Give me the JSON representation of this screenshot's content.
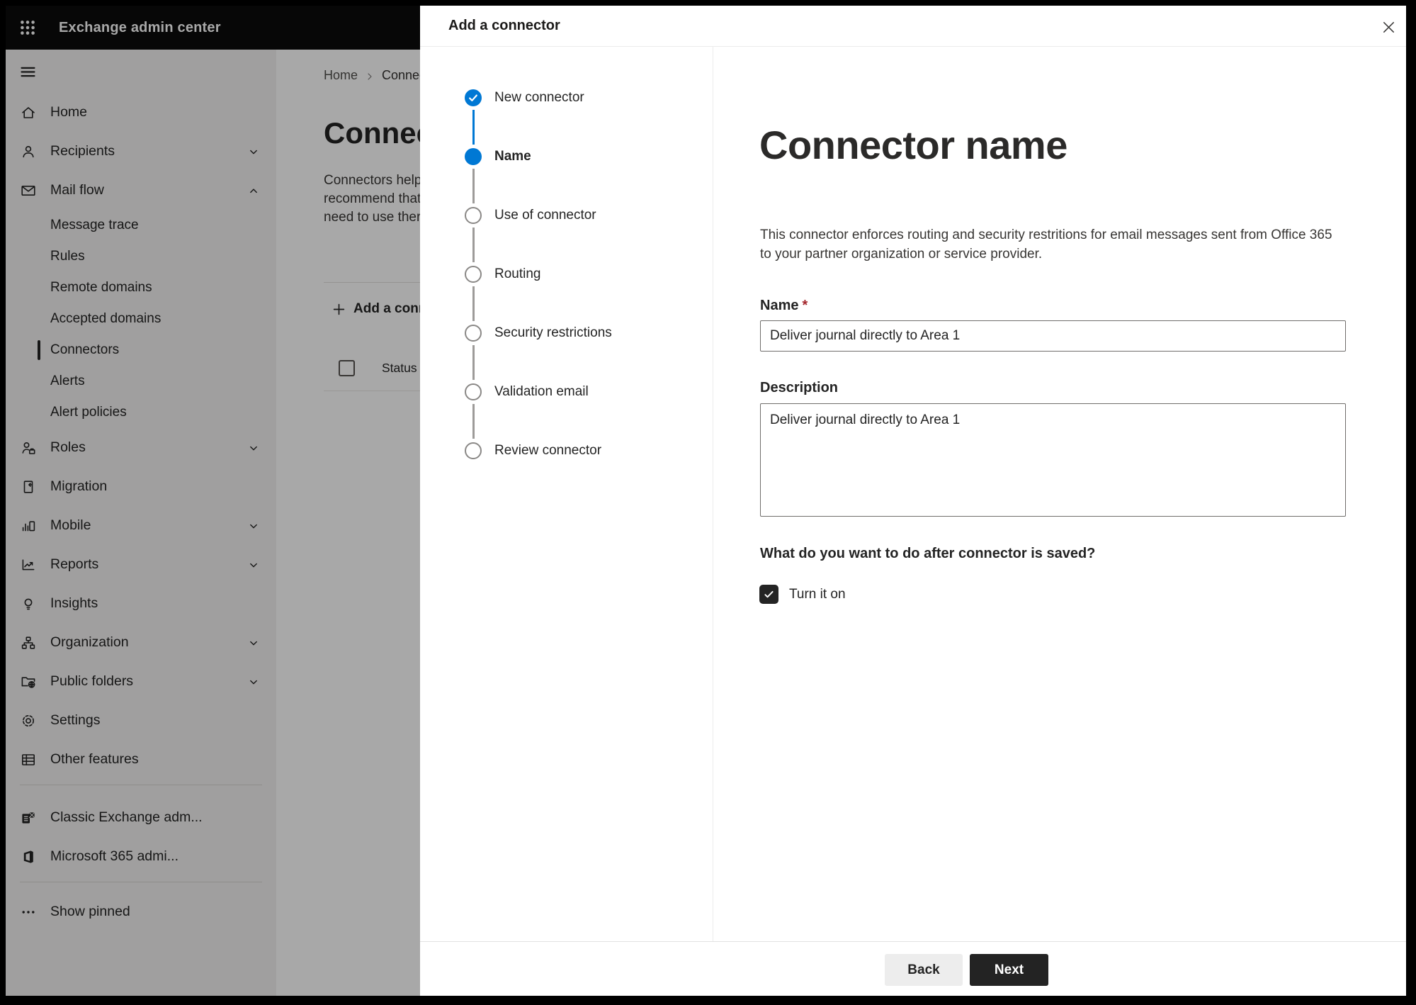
{
  "topbar": {
    "title": "Exchange admin center"
  },
  "sidebar": {
    "items": [
      {
        "label": "Home"
      },
      {
        "label": "Recipients"
      },
      {
        "label": "Mail flow"
      },
      {
        "label": "Message trace"
      },
      {
        "label": "Rules"
      },
      {
        "label": "Remote domains"
      },
      {
        "label": "Accepted domains"
      },
      {
        "label": "Connectors",
        "selected": true
      },
      {
        "label": "Alerts"
      },
      {
        "label": "Alert policies"
      },
      {
        "label": "Roles"
      },
      {
        "label": "Migration"
      },
      {
        "label": "Mobile"
      },
      {
        "label": "Reports"
      },
      {
        "label": "Insights"
      },
      {
        "label": "Organization"
      },
      {
        "label": "Public folders"
      },
      {
        "label": "Settings"
      },
      {
        "label": "Other features"
      },
      {
        "label": "Classic Exchange adm..."
      },
      {
        "label": "Microsoft 365 admi..."
      },
      {
        "label": "Show pinned"
      }
    ]
  },
  "main": {
    "breadcrumb": {
      "home": "Home",
      "current": "Connectors"
    },
    "title": "Connectors",
    "paragraph_lines": [
      "Connectors help",
      "recommend that",
      "need to use ther"
    ],
    "add_button_label": "Add a connector",
    "table": {
      "status_header": "Status"
    }
  },
  "dialog": {
    "title": "Add a connector",
    "steps": [
      {
        "label": "New connector",
        "state": "completed"
      },
      {
        "label": "Name",
        "state": "current"
      },
      {
        "label": "Use of connector",
        "state": "upcoming"
      },
      {
        "label": "Routing",
        "state": "upcoming"
      },
      {
        "label": "Security restrictions",
        "state": "upcoming"
      },
      {
        "label": "Validation email",
        "state": "upcoming"
      },
      {
        "label": "Review connector",
        "state": "upcoming"
      }
    ],
    "heading": "Connector name",
    "description_lines": [
      "This connector enforces routing and security restritions for email messages sent from Office 365",
      "to your partner organization or service provider."
    ],
    "name_label": "Name",
    "required_mark": "*",
    "name_value": "Deliver journal directly to Area 1",
    "description_label": "Description",
    "description_value": "Deliver journal directly to Area 1",
    "question": "What do you want to do after connector is saved?",
    "checkbox_label": "Turn it on",
    "checkbox_checked": true,
    "back_label": "Back",
    "next_label": "Next"
  },
  "colors": {
    "accent_blue": "#0078d4",
    "required_red": "#a4262c",
    "primary_button_bg": "#232323",
    "topbar_bg": "#0b0b0b",
    "sidebar_bg": "#f3f2f1"
  }
}
